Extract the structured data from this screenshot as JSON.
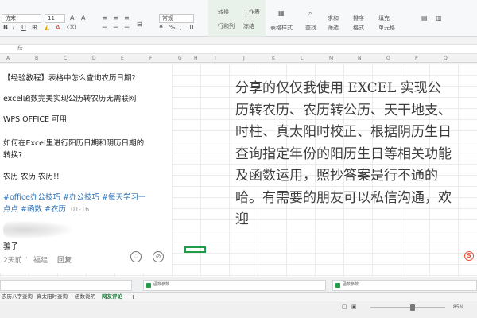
{
  "ribbon": {
    "font_name": "仿宋",
    "font_size": "11",
    "number_format": "常规",
    "groups": [
      "转换",
      "行和列",
      "工作表",
      "冻结",
      "表格样式",
      "查找",
      "求和",
      "筛选",
      "排序",
      "格式",
      "填充",
      "单元格"
    ]
  },
  "formula_bar": {
    "fx": "fx"
  },
  "columns": [
    "A",
    "B",
    "C",
    "D",
    "E",
    "F",
    "G",
    "H",
    "I",
    "J",
    "K",
    "L",
    "M",
    "N",
    "O",
    "P",
    "Q"
  ],
  "post": {
    "title": "【经验教程】表格中怎么查询农历日期?",
    "line1": "excel函数完美实现公历转农历无需联网",
    "line2": "WPS  OFFICE 可用",
    "question_line1": "如何在Excel里进行阳历日期和阴历日期的",
    "question_line2": "转换?",
    "calendar": "农历  农历  农历!!",
    "tags_line1": "#office办公技巧 #办公技巧 #每天学习一",
    "tags_line2": "点点 #函数 #农历",
    "date": "01-16",
    "reply": "骗子",
    "meta_time": "2天前",
    "meta_location": "福建",
    "meta_reply": "回复"
  },
  "comment_text": "分享的仅仅我使用 EXCEL 实现公历转农历、农历转公历、天干地支、时柱、真太阳时校正、根据阴历生日查询指定年份的阳历生日等相关功能及函数运用，照抄答案是行不通的哈。有需要的朋友可以私信沟通，欢迎",
  "panels": [
    {
      "label": "函数参数"
    },
    {
      "label": "函数参数"
    }
  ],
  "sheet_tabs": [
    "农历八字查询",
    "真太阳时查询",
    "函数说明",
    "网友评论",
    "+"
  ],
  "status": {
    "zoom": "85%"
  },
  "colors": {
    "accent": "#1f9d49",
    "tag": "#2f73b7"
  }
}
